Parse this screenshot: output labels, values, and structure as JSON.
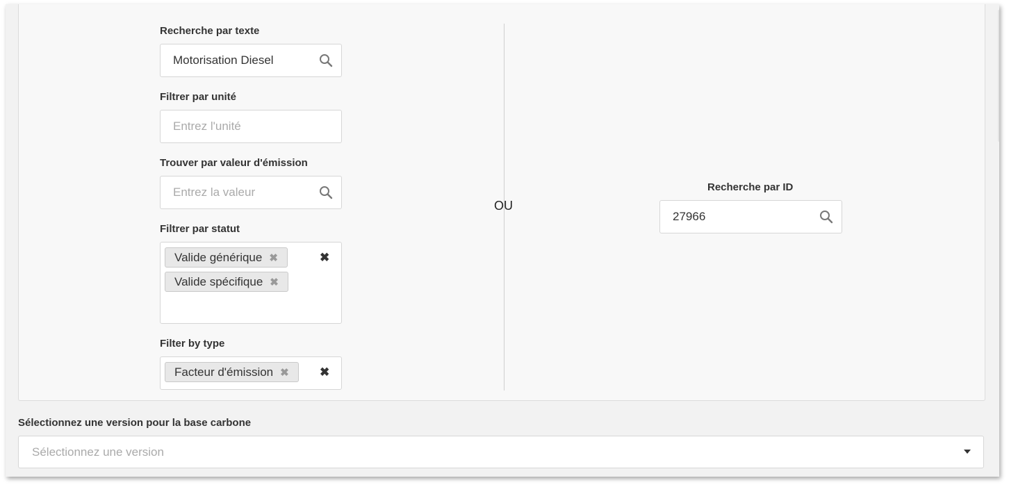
{
  "left_filters": {
    "text_search": {
      "label": "Recherche par texte",
      "value": "Motorisation Diesel"
    },
    "unit_filter": {
      "label": "Filtrer par unité",
      "placeholder": "Entrez l'unité"
    },
    "emission_value": {
      "label": "Trouver par valeur d'émission",
      "placeholder": "Entrez la valeur"
    },
    "status_filter": {
      "label": "Filtrer par statut",
      "chips": [
        "Valide générique",
        "Valide spécifique"
      ]
    },
    "type_filter": {
      "label": "Filter by type",
      "chips": [
        "Facteur d'émission"
      ]
    }
  },
  "separator": {
    "text": "OU"
  },
  "id_search": {
    "label": "Recherche par ID",
    "value": "27966"
  },
  "version": {
    "label": "Sélectionnez une version pour la base carbone",
    "placeholder": "Sélectionnez une version"
  },
  "icons": {
    "search": "search-icon",
    "chip_remove": "remove-chip-icon",
    "clear": "clear-icon",
    "dropdown": "caret-down-icon"
  }
}
